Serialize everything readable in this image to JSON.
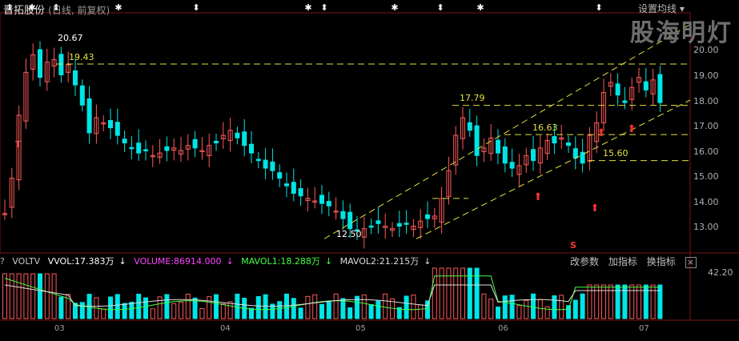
{
  "header": {
    "stock_name": "晋拓股份",
    "subtitle": "(日线, 前复权)",
    "settings_label": "设置均线",
    "watermark": "股海明灯"
  },
  "price_panel": {
    "y_ticks": [
      "20.00",
      "19.00",
      "18.00",
      "17.00",
      "16.00",
      "15.00",
      "14.00",
      "13.00"
    ],
    "annotations": {
      "high": "20.67",
      "low": "12.50",
      "level_1943": "19.43",
      "level_1779": "17.79",
      "level_1663": "16.63",
      "level_1560": "15.60",
      "t_marker": "T",
      "s_marker": "S"
    }
  },
  "volume_panel": {
    "indicator_name": "VOLTV",
    "vvol": "VVOL:17.383万",
    "volume": "VOLUME:86914.000",
    "mavol1": "MAVOL1:18.288万",
    "mavol2": "MAVOL2:21.215万",
    "y_top": "42.20",
    "buttons": {
      "modify": "改参数",
      "add": "加指标",
      "swap": "换指标",
      "close": "×"
    }
  },
  "x_axis": {
    "labels": [
      "03",
      "04",
      "05",
      "06",
      "07"
    ]
  },
  "colors": {
    "up": "#ff5a5a",
    "down": "#00e5e5",
    "guide": "#e0e040",
    "wvol": "#ffffff"
  }
}
